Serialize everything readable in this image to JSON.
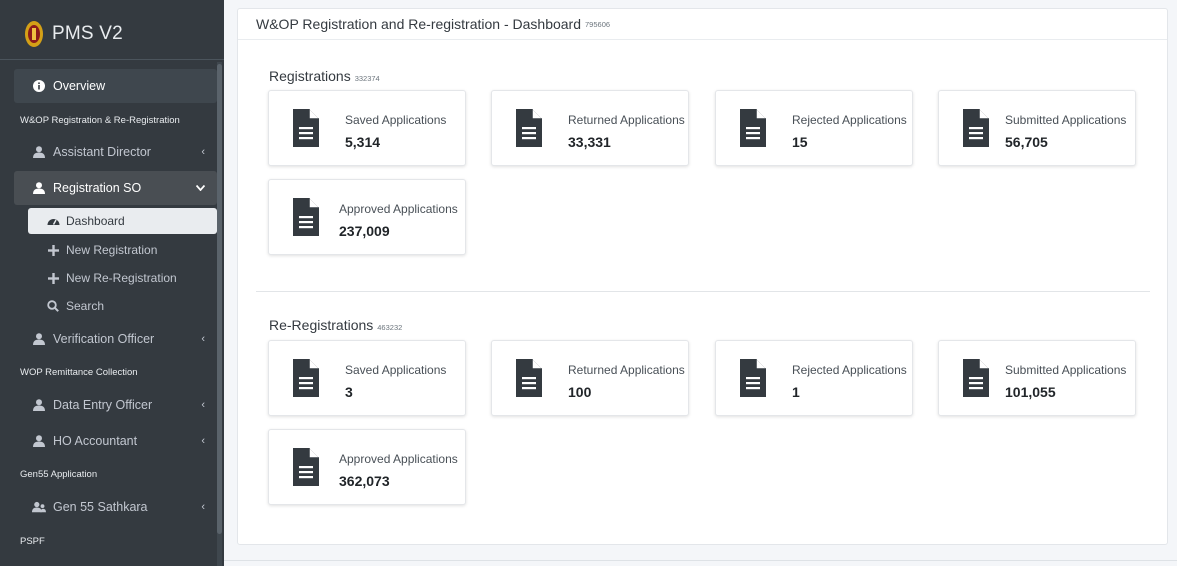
{
  "brand": {
    "title": "PMS V2",
    "logo_icon": "emblem-icon"
  },
  "sidebar": {
    "overview": "Overview",
    "headers": {
      "wop_registration": "W&OP Registration & Re-Registration",
      "wop_remittance": "WOP Remittance Collection",
      "gen55": "Gen55 Application",
      "pspf": "PSPF"
    },
    "items": {
      "assistant_director": "Assistant Director",
      "registration_so": "Registration SO",
      "dashboard": "Dashboard",
      "new_registration": "New Registration",
      "new_re_registration": "New Re-Registration",
      "search": "Search",
      "verification_officer": "Verification Officer",
      "data_entry_officer": "Data Entry Officer",
      "ho_accountant": "HO Accountant",
      "gen55_sathkara": "Gen 55 Sathkara"
    }
  },
  "page": {
    "title": "W&OP Registration and Re-registration - Dashboard",
    "title_count": "795606"
  },
  "registrations": {
    "title": "Registrations",
    "count": "332374",
    "saved_label": "Saved Applications",
    "saved_value": "5,314",
    "returned_label": "Returned Applications",
    "returned_value": "33,331",
    "rejected_label": "Rejected Applications",
    "rejected_value": "15",
    "submitted_label": "Submitted Applications",
    "submitted_value": "56,705",
    "approved_label": "Approved Applications",
    "approved_value": "237,009"
  },
  "re_registrations": {
    "title": "Re-Registrations",
    "count": "463232",
    "saved_label": "Saved Applications",
    "saved_value": "3",
    "returned_label": "Returned Applications",
    "returned_value": "100",
    "rejected_label": "Rejected Applications",
    "rejected_value": "1",
    "submitted_label": "Submitted Applications",
    "submitted_value": "101,055",
    "approved_label": "Approved Applications",
    "approved_value": "362,073"
  },
  "colors": {
    "sidebar_bg": "#343a40",
    "doc_icon": "#343a40",
    "main_bg": "#f4f6f9"
  }
}
